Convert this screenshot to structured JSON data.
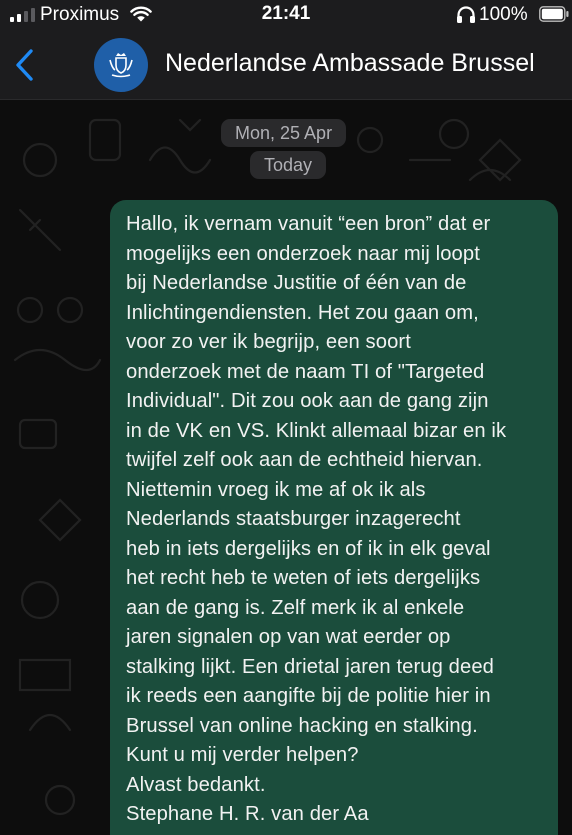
{
  "status_bar": {
    "carrier": "Proximus",
    "time": "21:41",
    "battery": "100%"
  },
  "header": {
    "contact_name": "Nederlandse Ambassade Brussel",
    "back_icon": "chevron-left-icon",
    "avatar_icon": "coat-of-arms-icon"
  },
  "chat": {
    "date_label": "Mon, 25 Apr",
    "today_label": "Today",
    "messages": [
      {
        "direction": "outgoing",
        "text": "Hallo, ik vernam vanuit “een bron” dat er\nmogelijks een onderzoek naar mij loopt\nbij Nederlandse Justitie of één van de\nInlichtingendiensten. Het zou gaan om,\nvoor zo ver ik begrijp, een soort\nonderzoek met de naam TI of \"Targeted\nIndividual\".  Dit zou ook aan de gang zijn\nin de VK en VS. Klinkt allemaal bizar en ik\ntwijfel zelf ook aan de echtheid hiervan.\nNiettemin vroeg ik me af ok ik als\nNederlands staatsburger inzagerecht\nheb in iets dergelijks en of ik in elk geval\nhet recht heb te weten of iets dergelijks\naan de gang is.  Zelf merk ik al enkele\njaren signalen op van wat eerder op\nstalking lijkt. Een drietal jaren terug deed\nik reeds een aangifte bij de politie hier in\nBrussel van online hacking en stalking.\nKunt u mij verder helpen?\nAlvast bedankt.\nStephane H. R. van der Aa"
      }
    ]
  },
  "colors": {
    "accent": "#1f8af5",
    "bubble_outgoing": "#1b4d3c",
    "bar_background": "#1c1c1e"
  }
}
